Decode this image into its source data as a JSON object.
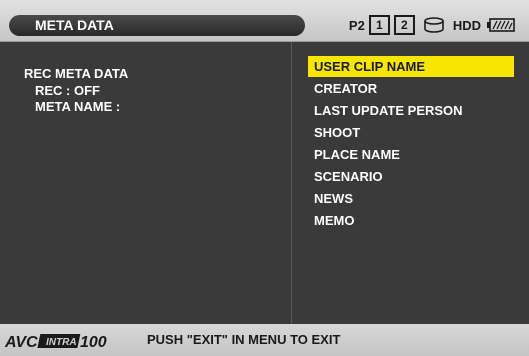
{
  "header": {
    "title": "META DATA",
    "media_label": "P2",
    "slot_1": "1",
    "slot_2": "2",
    "hdd_label": "HDD"
  },
  "left_panel": {
    "heading": "REC META DATA",
    "rec_status": "REC : OFF",
    "meta_name": "META NAME :"
  },
  "menu": {
    "items": [
      {
        "label": "USER CLIP NAME",
        "selected": true
      },
      {
        "label": "CREATOR"
      },
      {
        "label": "LAST UPDATE PERSON"
      },
      {
        "label": "SHOOT"
      },
      {
        "label": "PLACE NAME"
      },
      {
        "label": "SCENARIO"
      },
      {
        "label": "NEWS"
      },
      {
        "label": "MEMO"
      }
    ]
  },
  "footer": {
    "logo_text": "AVC INTRA 100",
    "message": "PUSH \"EXIT\" IN MENU TO EXIT"
  },
  "colors": {
    "selection": "#f6e600",
    "background": "#3a3a3a",
    "bar": "#d0d0d0"
  },
  "icons": [
    "disk-slot-icon",
    "battery-icon"
  ]
}
